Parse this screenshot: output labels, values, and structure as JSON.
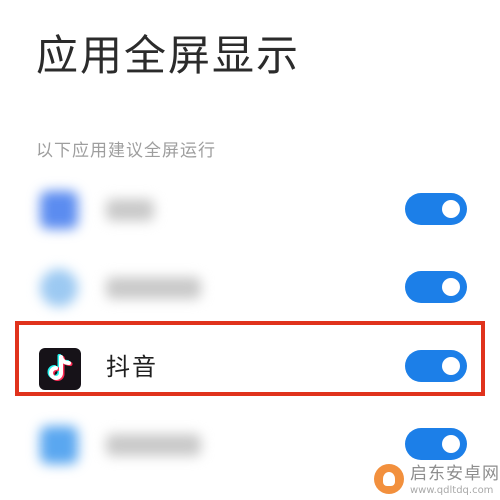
{
  "header": {
    "title": "应用全屏显示"
  },
  "section": {
    "hint": "以下应用建议全屏运行"
  },
  "apps": [
    {
      "name": "",
      "blurred": true,
      "enabled": true,
      "icon": "blurred-blue-app-icon"
    },
    {
      "name": "",
      "blurred": true,
      "enabled": true,
      "icon": "blurred-lightblue-app-icon"
    },
    {
      "name": "抖音",
      "blurred": false,
      "enabled": true,
      "icon": "tiktok-icon",
      "highlighted": true
    },
    {
      "name": "",
      "blurred": true,
      "enabled": true,
      "icon": "blurred-sky-app-icon"
    }
  ],
  "colors": {
    "toggle_on": "#1c7fe8",
    "highlight_border": "#e0321c",
    "title_text": "#2b2b2b",
    "hint_text": "#9e9e9e"
  },
  "watermark": {
    "title": "启东安卓网",
    "url": "www.qdltdq.com"
  }
}
